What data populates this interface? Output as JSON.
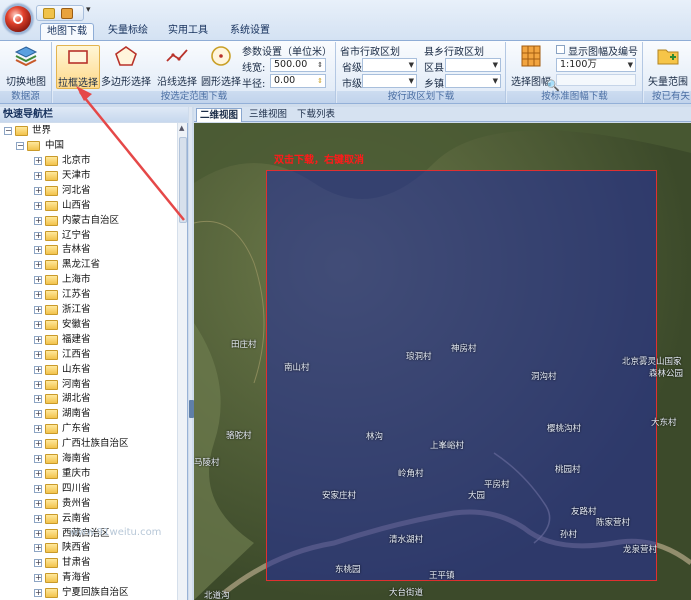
{
  "tabs": [
    "地图下载",
    "矢量标绘",
    "实用工具",
    "系统设置"
  ],
  "ribbon": {
    "datasource": {
      "btn": "切换地图",
      "label": "数据源"
    },
    "range": {
      "btn_rect": "拉框选择",
      "btn_poly": "多边形选择",
      "btn_line": "沿线选择",
      "btn_circle": "圆形选择",
      "params_title": "参数设置（单位米）",
      "line_label": "线宽:",
      "line_value": "500.00",
      "radius_label": "半径:",
      "radius_value": "0.00",
      "label": "按选定范围下载"
    },
    "admin": {
      "title1": "省市行政区划",
      "title2": "县乡行政区划",
      "prov": "省级",
      "city": "市级",
      "county": "区县",
      "town": "乡镇",
      "label": "按行政区划下载"
    },
    "sheet": {
      "btn": "选择图幅",
      "checkbox": "显示图幅及编号",
      "scale": "1:100万",
      "label": "按标准图幅下载"
    },
    "vector": {
      "btn": "矢量范围",
      "label": "按已有矢"
    }
  },
  "nav": {
    "title": "快速导航栏",
    "world": "世界",
    "country": "中国",
    "provinces": [
      "北京市",
      "天津市",
      "河北省",
      "山西省",
      "内蒙古自治区",
      "辽宁省",
      "吉林省",
      "黑龙江省",
      "上海市",
      "江苏省",
      "浙江省",
      "安徽省",
      "福建省",
      "江西省",
      "山东省",
      "河南省",
      "湖北省",
      "湖南省",
      "广东省",
      "广西壮族自治区",
      "海南省",
      "重庆市",
      "四川省",
      "贵州省",
      "云南省",
      "西藏自治区",
      "陕西省",
      "甘肃省",
      "青海省",
      "宁夏回族自治区"
    ]
  },
  "map": {
    "tabs": [
      "二维视图",
      "三维视图",
      "下载列表"
    ],
    "hint": "双击下载，右键取消",
    "watermark": "www.91weitu.com",
    "places": [
      "田庄村",
      "南山村",
      "琅洞村",
      "神房村",
      "洞沟村",
      "北京雾灵山国家",
      "森林公园",
      "林沟",
      "上峯峪村",
      "樱桃沟村",
      "大东村",
      "骆驼村",
      "马陵村",
      "平房村",
      "岭角村",
      "桃园村",
      "安家庄村",
      "大园",
      "友路村",
      "清水湖村",
      "孙村",
      "陈家营村",
      "龙泉营村",
      "东桃园",
      "王平镇",
      "北道沟",
      "大台街道"
    ]
  },
  "colors": {
    "selection": "#2b3b9c",
    "selection_border": "#e03030",
    "hint": "#ff1a1a",
    "arrow": "#e54848"
  }
}
